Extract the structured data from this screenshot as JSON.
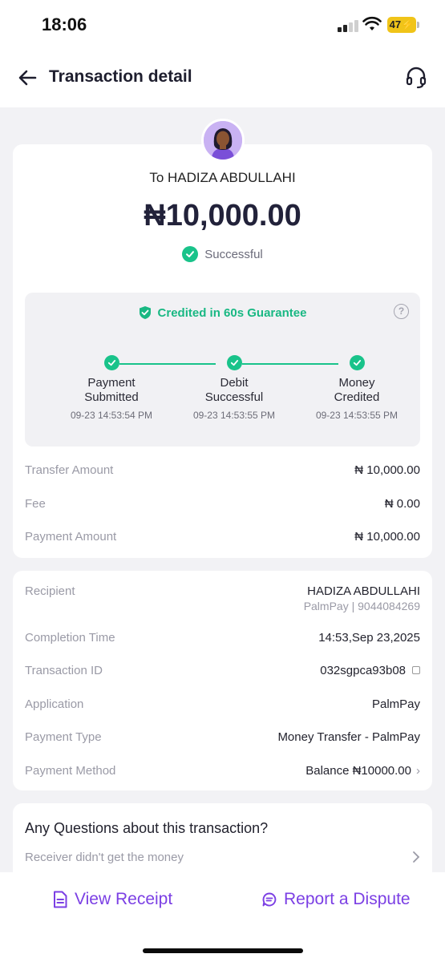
{
  "status": {
    "time": "18:06",
    "battery": "47"
  },
  "header": {
    "title": "Transaction detail"
  },
  "summary": {
    "recipient_line": "To HADIZA ABDULLAHI",
    "amount": "₦10,000.00",
    "status": "Successful"
  },
  "guarantee": {
    "title": "Credited in 60s Guarantee",
    "help": "?",
    "steps": [
      {
        "label_line1": "Payment",
        "label_line2": "Submitted",
        "time": "09-23 14:53:54 PM"
      },
      {
        "label_line1": "Debit",
        "label_line2": "Successful",
        "time": "09-23 14:53:55 PM"
      },
      {
        "label_line1": "Money",
        "label_line2": "Credited",
        "time": "09-23 14:53:55 PM"
      }
    ]
  },
  "amounts": [
    {
      "label": "Transfer Amount",
      "value": "₦ 10,000.00"
    },
    {
      "label": "Fee",
      "value": "₦ 0.00"
    },
    {
      "label": "Payment Amount",
      "value": "₦ 10,000.00"
    }
  ],
  "details": {
    "recipient_label": "Recipient",
    "recipient_name": "HADIZA ABDULLAHI",
    "recipient_sub": "PalmPay | 9044084269",
    "completion_label": "Completion Time",
    "completion_value": "14:53,Sep 23,2025",
    "txid_label": "Transaction ID",
    "txid_value": "032sgpca93b08",
    "application_label": "Application",
    "application_value": "PalmPay",
    "payment_type_label": "Payment Type",
    "payment_type_value": "Money Transfer - PalmPay",
    "payment_method_label": "Payment Method",
    "payment_method_value": "Balance ₦10000.00"
  },
  "questions": {
    "title": "Any Questions about this transaction?",
    "item": "Receiver didn't get the money"
  },
  "actions": {
    "view_receipt": "View Receipt",
    "report_dispute": "Report a Dispute"
  },
  "colors": {
    "accent": "#7b3fe4",
    "success": "#19c38a"
  }
}
